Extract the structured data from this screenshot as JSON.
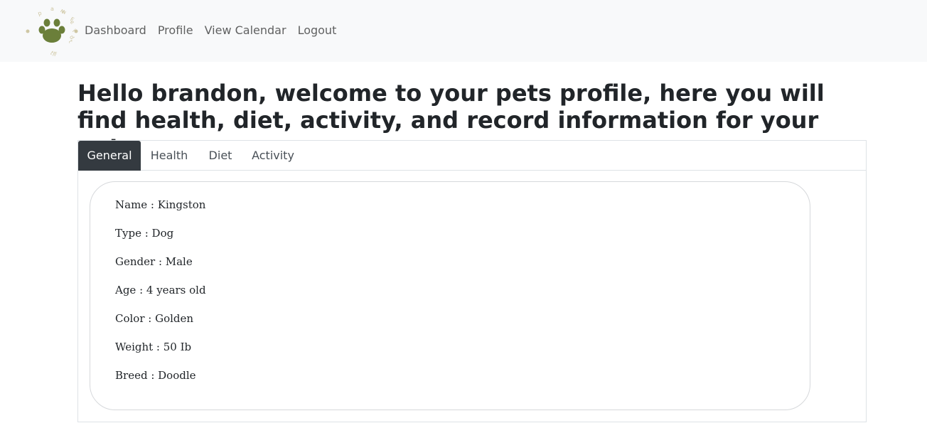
{
  "nav": {
    "items": [
      {
        "label": "Dashboard"
      },
      {
        "label": "Profile"
      },
      {
        "label": "View Calendar"
      },
      {
        "label": "Logout"
      }
    ]
  },
  "logo": {
    "ring_text": "pawfit pawfit",
    "paw_color": "#6b7f3a",
    "ring_color": "#cfc7a4"
  },
  "main": {
    "title": "Hello brandon, welcome to your pets profile, here you will find health, diet, activity, and record information for your pet."
  },
  "tabs": [
    {
      "label": "General",
      "active": true
    },
    {
      "label": "Health",
      "active": false
    },
    {
      "label": "Diet",
      "active": false
    },
    {
      "label": "Activity",
      "active": false
    }
  ],
  "pet": {
    "lines": [
      "Name : Kingston",
      "Type : Dog",
      "Gender : Male",
      "Age : 4 years old",
      "Color : Golden",
      "Weight : 50 Ib",
      "Breed : Doodle"
    ]
  },
  "colors": {
    "navbar_bg": "#f8f9fa",
    "active_tab_bg": "#343a40",
    "border": "#dee2e6"
  }
}
